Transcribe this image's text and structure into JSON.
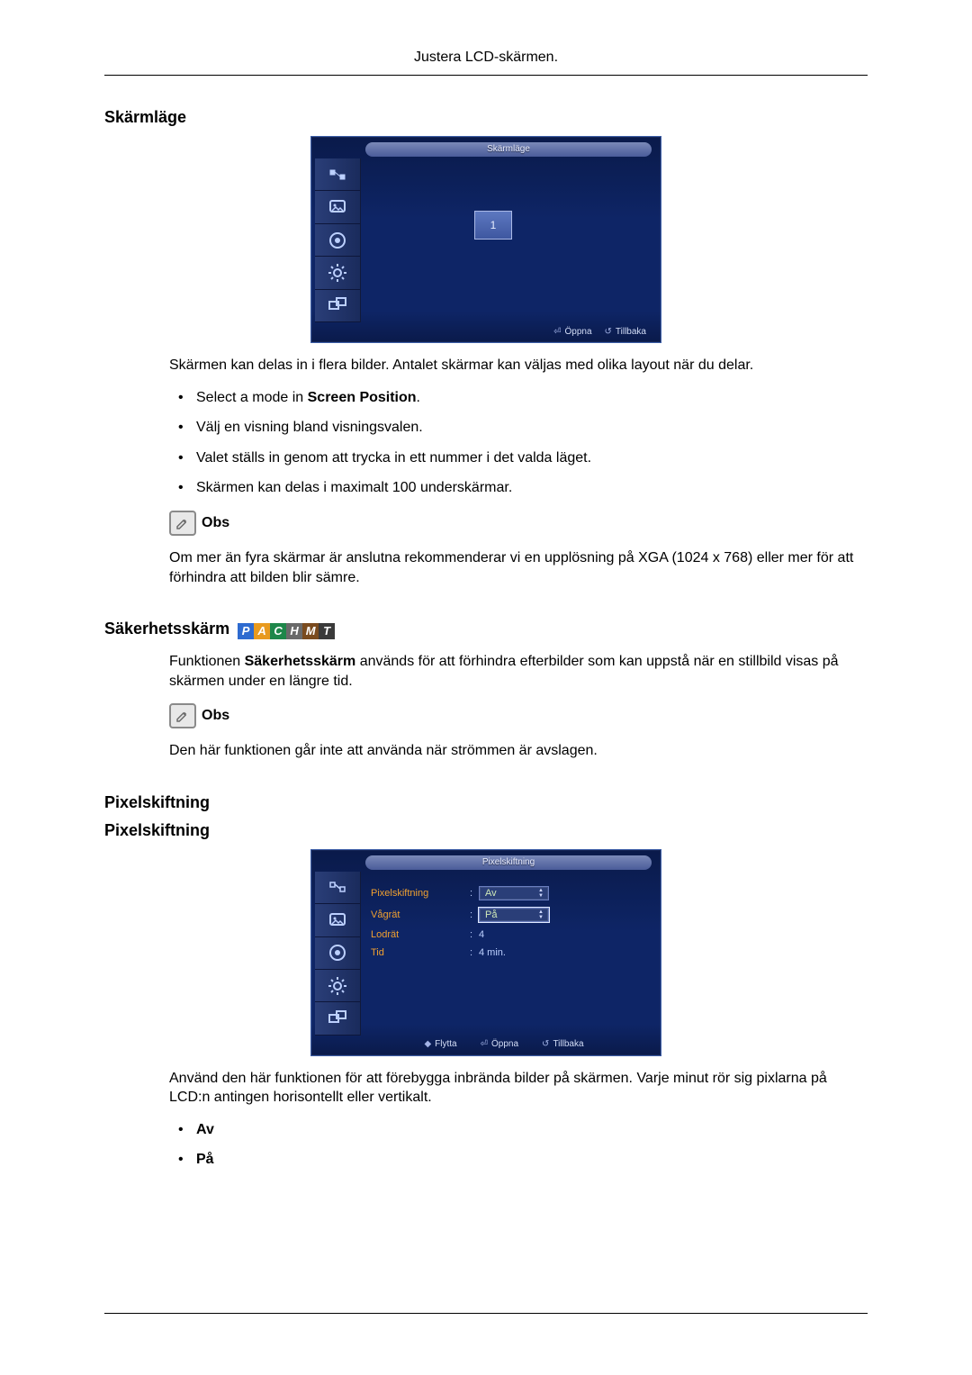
{
  "page_header": "Justera LCD-skärmen.",
  "section1": {
    "title": "Skärmläge",
    "osd": {
      "title": "Skärmläge",
      "grid_num": "1",
      "open_label": "Öppna",
      "back_label": "Tillbaka"
    },
    "para1": "Skärmen kan delas in i flera bilder. Antalet skärmar kan väljas med olika layout när du delar.",
    "b1_pre": "Select a mode in ",
    "b1_bold": "Screen Position",
    "b1_post": ".",
    "b2": "Välj en visning bland visningsvalen.",
    "b3": "Valet ställs in genom att trycka in ett nummer i det valda läget.",
    "b4": "Skärmen kan delas i maximalt 100 underskärmar.",
    "note_label": "Obs",
    "note_text": "Om mer än fyra skärmar är anslutna rekommenderar vi en upplösning på XGA (1024 x 768) eller mer för att förhindra att bilden blir sämre."
  },
  "section2": {
    "title": "Säkerhetsskärm",
    "p1_pre": "Funktionen ",
    "p1_bold": "Säkerhetsskärm",
    "p1_post": " används för att förhindra efterbilder som kan uppstå när en stillbild visas på skärmen under en längre tid.",
    "note_label": "Obs",
    "note_text": "Den här funktionen går inte att använda när strömmen är avslagen."
  },
  "section3": {
    "title1": "Pixelskiftning",
    "title2": "Pixelskiftning",
    "osd": {
      "title": "Pixelskiftning",
      "row_labels": {
        "pixelshift": "Pixelskiftning",
        "horizontal": "Vågrät",
        "vertical": "Lodrät",
        "time": "Tid"
      },
      "values": {
        "pixelshift": "Av",
        "horizontal": "På",
        "vertical": "4",
        "time": "4 min."
      },
      "move_label": "Flytta",
      "open_label": "Öppna",
      "back_label": "Tillbaka"
    },
    "para": "Använd den här funktionen för att förebygga inbrända bilder på skärmen. Varje minut rör sig pixlarna på LCD:n antingen horisontellt eller vertikalt.",
    "opt_off": "Av",
    "opt_on": "På"
  }
}
